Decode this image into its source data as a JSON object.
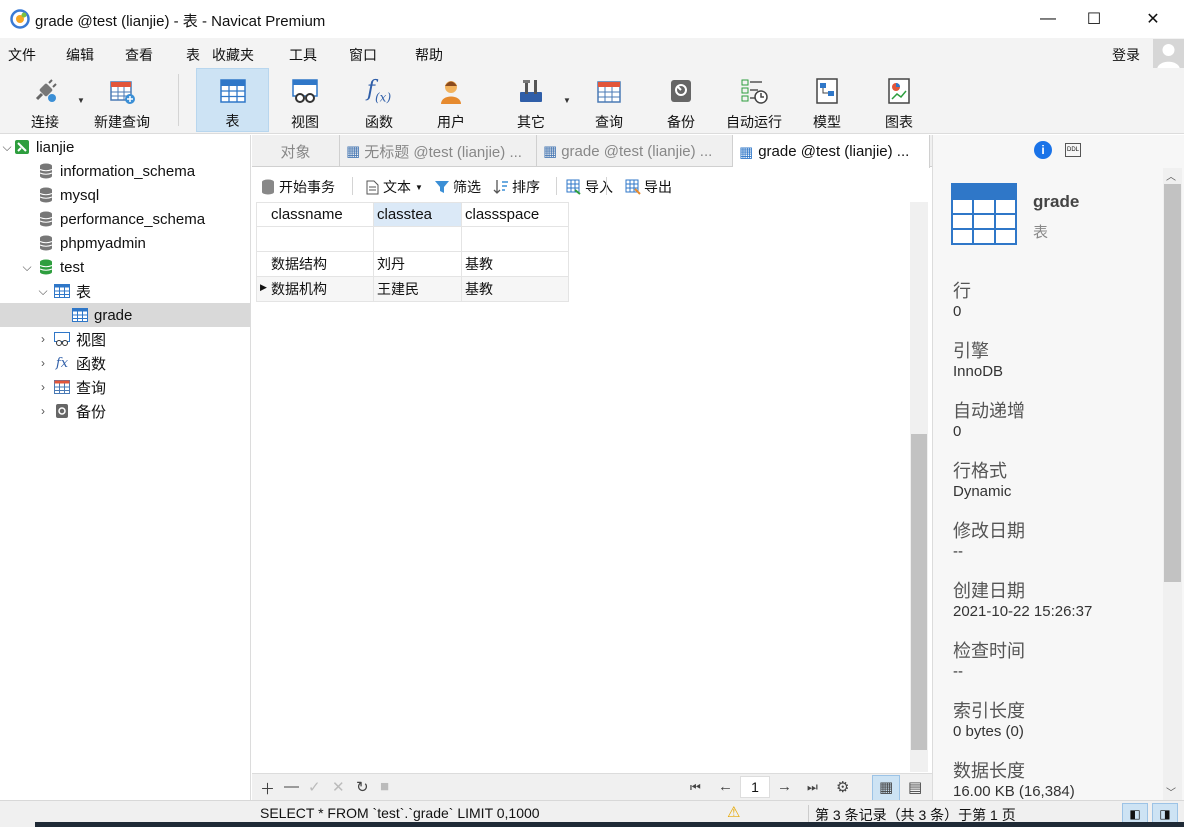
{
  "window": {
    "title": "grade @test (lianjie) - 表 - Navicat Premium",
    "minimize": "—",
    "maximize": "☐",
    "close": "✕"
  },
  "menu": [
    "文件",
    "编辑",
    "查看",
    "表",
    "收藏夹",
    "工具",
    "窗口",
    "帮助"
  ],
  "login_label": "登录",
  "toolbar": [
    {
      "label": "连接",
      "icon": "plug-icon"
    },
    {
      "label": "新建查询",
      "icon": "new-query-icon"
    },
    {
      "label": "表",
      "icon": "table-icon",
      "active": true
    },
    {
      "label": "视图",
      "icon": "view-icon"
    },
    {
      "label": "函数",
      "icon": "function-icon"
    },
    {
      "label": "用户",
      "icon": "user-icon"
    },
    {
      "label": "其它",
      "icon": "tools-icon"
    },
    {
      "label": "查询",
      "icon": "query-icon"
    },
    {
      "label": "备份",
      "icon": "backup-icon"
    },
    {
      "label": "自动运行",
      "icon": "schedule-icon"
    },
    {
      "label": "模型",
      "icon": "model-icon"
    },
    {
      "label": "图表",
      "icon": "chart-icon"
    }
  ],
  "nav": {
    "connection": "lianjie",
    "databases": [
      "information_schema",
      "mysql",
      "performance_schema",
      "phpmyadmin",
      "test"
    ],
    "tables_label": "表",
    "selected_table": "grade",
    "groups": [
      "视图",
      "函数",
      "查询",
      "备份"
    ]
  },
  "tabs": [
    {
      "label": "对象"
    },
    {
      "label": "无标题 @test (lianjie) ..."
    },
    {
      "label": "grade @test (lianjie) ..."
    },
    {
      "label": "grade @test (lianjie) ...",
      "active": true
    }
  ],
  "subtoolbar": {
    "begin_tx": "开始事务",
    "text": "文本",
    "filter": "筛选",
    "sort": "排序",
    "import": "导入",
    "export": "导出"
  },
  "grid": {
    "columns": [
      "classname",
      "classtea",
      "classspace"
    ],
    "rows": [
      [
        "",
        "",
        ""
      ],
      [
        "数据结构",
        "刘丹",
        "基教"
      ],
      [
        "数据机构",
        "王建民",
        "基教"
      ]
    ],
    "current_row": 2
  },
  "grid_footer": {
    "page": "1"
  },
  "info": {
    "name": "grade",
    "type": "表",
    "fields": [
      {
        "label": "行",
        "value": "0"
      },
      {
        "label": "引擎",
        "value": "InnoDB"
      },
      {
        "label": "自动递增",
        "value": "0"
      },
      {
        "label": "行格式",
        "value": "Dynamic"
      },
      {
        "label": "修改日期",
        "value": "--"
      },
      {
        "label": "创建日期",
        "value": "2021-10-22 15:26:37"
      },
      {
        "label": "检查时间",
        "value": "--"
      },
      {
        "label": "索引长度",
        "value": "0 bytes (0)"
      },
      {
        "label": "数据长度",
        "value": "16.00 KB (16,384)"
      }
    ]
  },
  "status": {
    "sql": "SELECT * FROM `test`.`grade` LIMIT 0,1000",
    "records": "第 3 条记录（共 3 条）于第 1 页"
  },
  "colors": {
    "accent": "#cde3f4",
    "db_green": "#2e9e3e",
    "info_blue": "#1a73e8"
  }
}
